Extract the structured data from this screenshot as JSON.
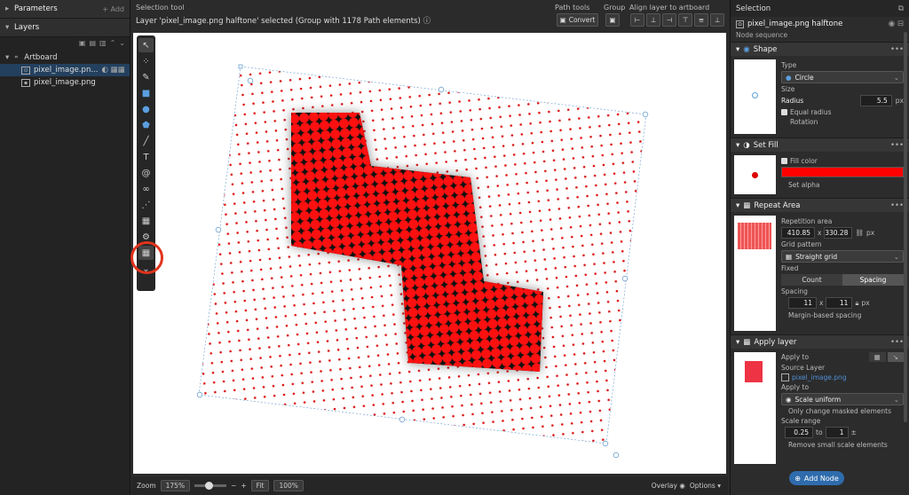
{
  "left_panel": {
    "parameters_title": "Parameters",
    "add_label": "+ Add",
    "layers_title": "Layers",
    "layers": [
      {
        "name": "Artboard"
      },
      {
        "name": "pixel_image.pn..."
      },
      {
        "name": "pixel_image.png"
      }
    ]
  },
  "header": {
    "selection_tool": "Selection tool",
    "status": "Layer 'pixel_image.png halftone' selected (Group with 1178 Path elements)",
    "path_tools": "Path tools",
    "convert": "Convert",
    "group": "Group",
    "align": "Align layer to artboard"
  },
  "bottom": {
    "zoom_label": "Zoom",
    "zoom_value": "175%",
    "fit": "Fit",
    "percent100": "100%",
    "overlay": "Overlay",
    "options": "Options"
  },
  "right": {
    "selection": "Selection",
    "node_title": "pixel_image.png halftone",
    "node_sequence": "Node sequence",
    "shape": {
      "title": "Shape",
      "type_label": "Type",
      "type_value": "Circle",
      "size_label": "Size",
      "radius_label": "Radius",
      "radius_value": "5.5",
      "unit": "px",
      "equal_radius": "Equal radius",
      "rotation": "Rotation"
    },
    "fill": {
      "title": "Set Fill",
      "fill_color": "Fill color",
      "color": "#ff0000",
      "set_alpha": "Set alpha"
    },
    "repeat": {
      "title": "Repeat Area",
      "rep_area": "Repetition area",
      "w": "410.85",
      "h": "330.28",
      "unit": "px",
      "x_sep": "x",
      "grid_pattern": "Grid pattern",
      "grid_value": "Straight grid",
      "fixed": "Fixed",
      "count": "Count",
      "spacing_btn": "Spacing",
      "spacing_label": "Spacing",
      "sx": "11",
      "sy": "11",
      "margin": "Margin-based spacing"
    },
    "apply": {
      "title": "Apply layer",
      "apply_to": "Apply to",
      "source_layer": "Source Layer",
      "source_value": "pixel_image.png",
      "apply_to2": "Apply to",
      "scale_value": "Scale uniform",
      "only_masked": "Only change masked elements",
      "scale_range": "Scale range",
      "min": "0.25",
      "to": "to",
      "max": "1",
      "remove_small": "Remove small scale elements"
    },
    "add_node": "Add Node"
  }
}
